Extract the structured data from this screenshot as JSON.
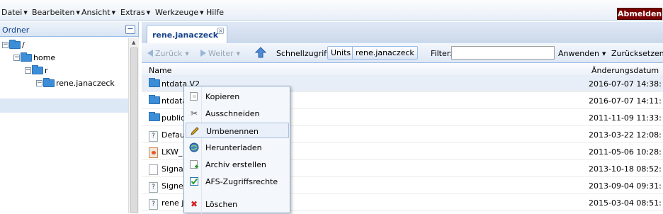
{
  "menubar": {
    "items": [
      "Datei",
      "Bearbeiten",
      "Ansicht",
      "Extras",
      "Werkzeuge",
      "Hilfe"
    ],
    "logout_label": "Abmelden"
  },
  "left_panel": {
    "title": "Ordner",
    "collapse_label": "−",
    "tree": [
      {
        "label": "/"
      },
      {
        "label": "home"
      },
      {
        "label": "r"
      },
      {
        "label": "rene.janaczeck"
      }
    ]
  },
  "tab": {
    "label": "rene.janaczeck",
    "close_label": "×"
  },
  "toolbar": {
    "back_label": "Zurück",
    "forward_label": "Weiter",
    "quickaccess_label": "Schnellzugriff:",
    "quick_buttons": [
      "Units",
      "rene.janaczeck"
    ],
    "filter_label": "Filter:",
    "filter_value": "",
    "apply_label": "Anwenden",
    "reset_label": "Zurücksetzen"
  },
  "columns": {
    "name": "Name",
    "date": "Änderungsdatum"
  },
  "files": [
    {
      "name": "ntdata V2",
      "date": "2016-07-07 14:38:",
      "icon": "folder-icon"
    },
    {
      "name": "ntdata",
      "date": "2016-07-07 14:11:",
      "icon": "folder-icon"
    },
    {
      "name": "public_",
      "date": "2011-11-09 11:33:",
      "icon": "folder-icon"
    },
    {
      "name": "Defaul",
      "date": "2013-03-22 12:08:",
      "icon": "unknown-file-icon"
    },
    {
      "name": "LKW_",
      "date": "2011-05-06 10:28:",
      "icon": "xml-file-icon"
    },
    {
      "name": "Signat",
      "date": "2013-10-18 08:52:",
      "icon": "document-icon"
    },
    {
      "name": "Signed",
      "date": "2013-09-04 09:31:",
      "icon": "unknown-file-icon"
    },
    {
      "name": "rene ja",
      "date": "2015-03-04 08:51:",
      "icon": "unknown-file-icon"
    }
  ],
  "context_menu": {
    "items": [
      {
        "label": "Kopieren",
        "icon": "copy-icon"
      },
      {
        "label": "Ausschneiden",
        "icon": "scissors-icon"
      },
      {
        "label": "Umbenennen",
        "icon": "pencil-icon"
      },
      {
        "label": "Herunterladen",
        "icon": "globe-download-icon"
      },
      {
        "label": "Archiv erstellen",
        "icon": "archive-icon"
      },
      {
        "label": "AFS-Zugriffsrechte",
        "icon": "checkbox-icon"
      },
      {
        "label": "Löschen",
        "icon": "delete-icon"
      }
    ]
  },
  "colors": {
    "accent": "#15428b",
    "logout": "#7a0000",
    "folder": "#3c8ed8",
    "selection": "#dde8f7"
  }
}
